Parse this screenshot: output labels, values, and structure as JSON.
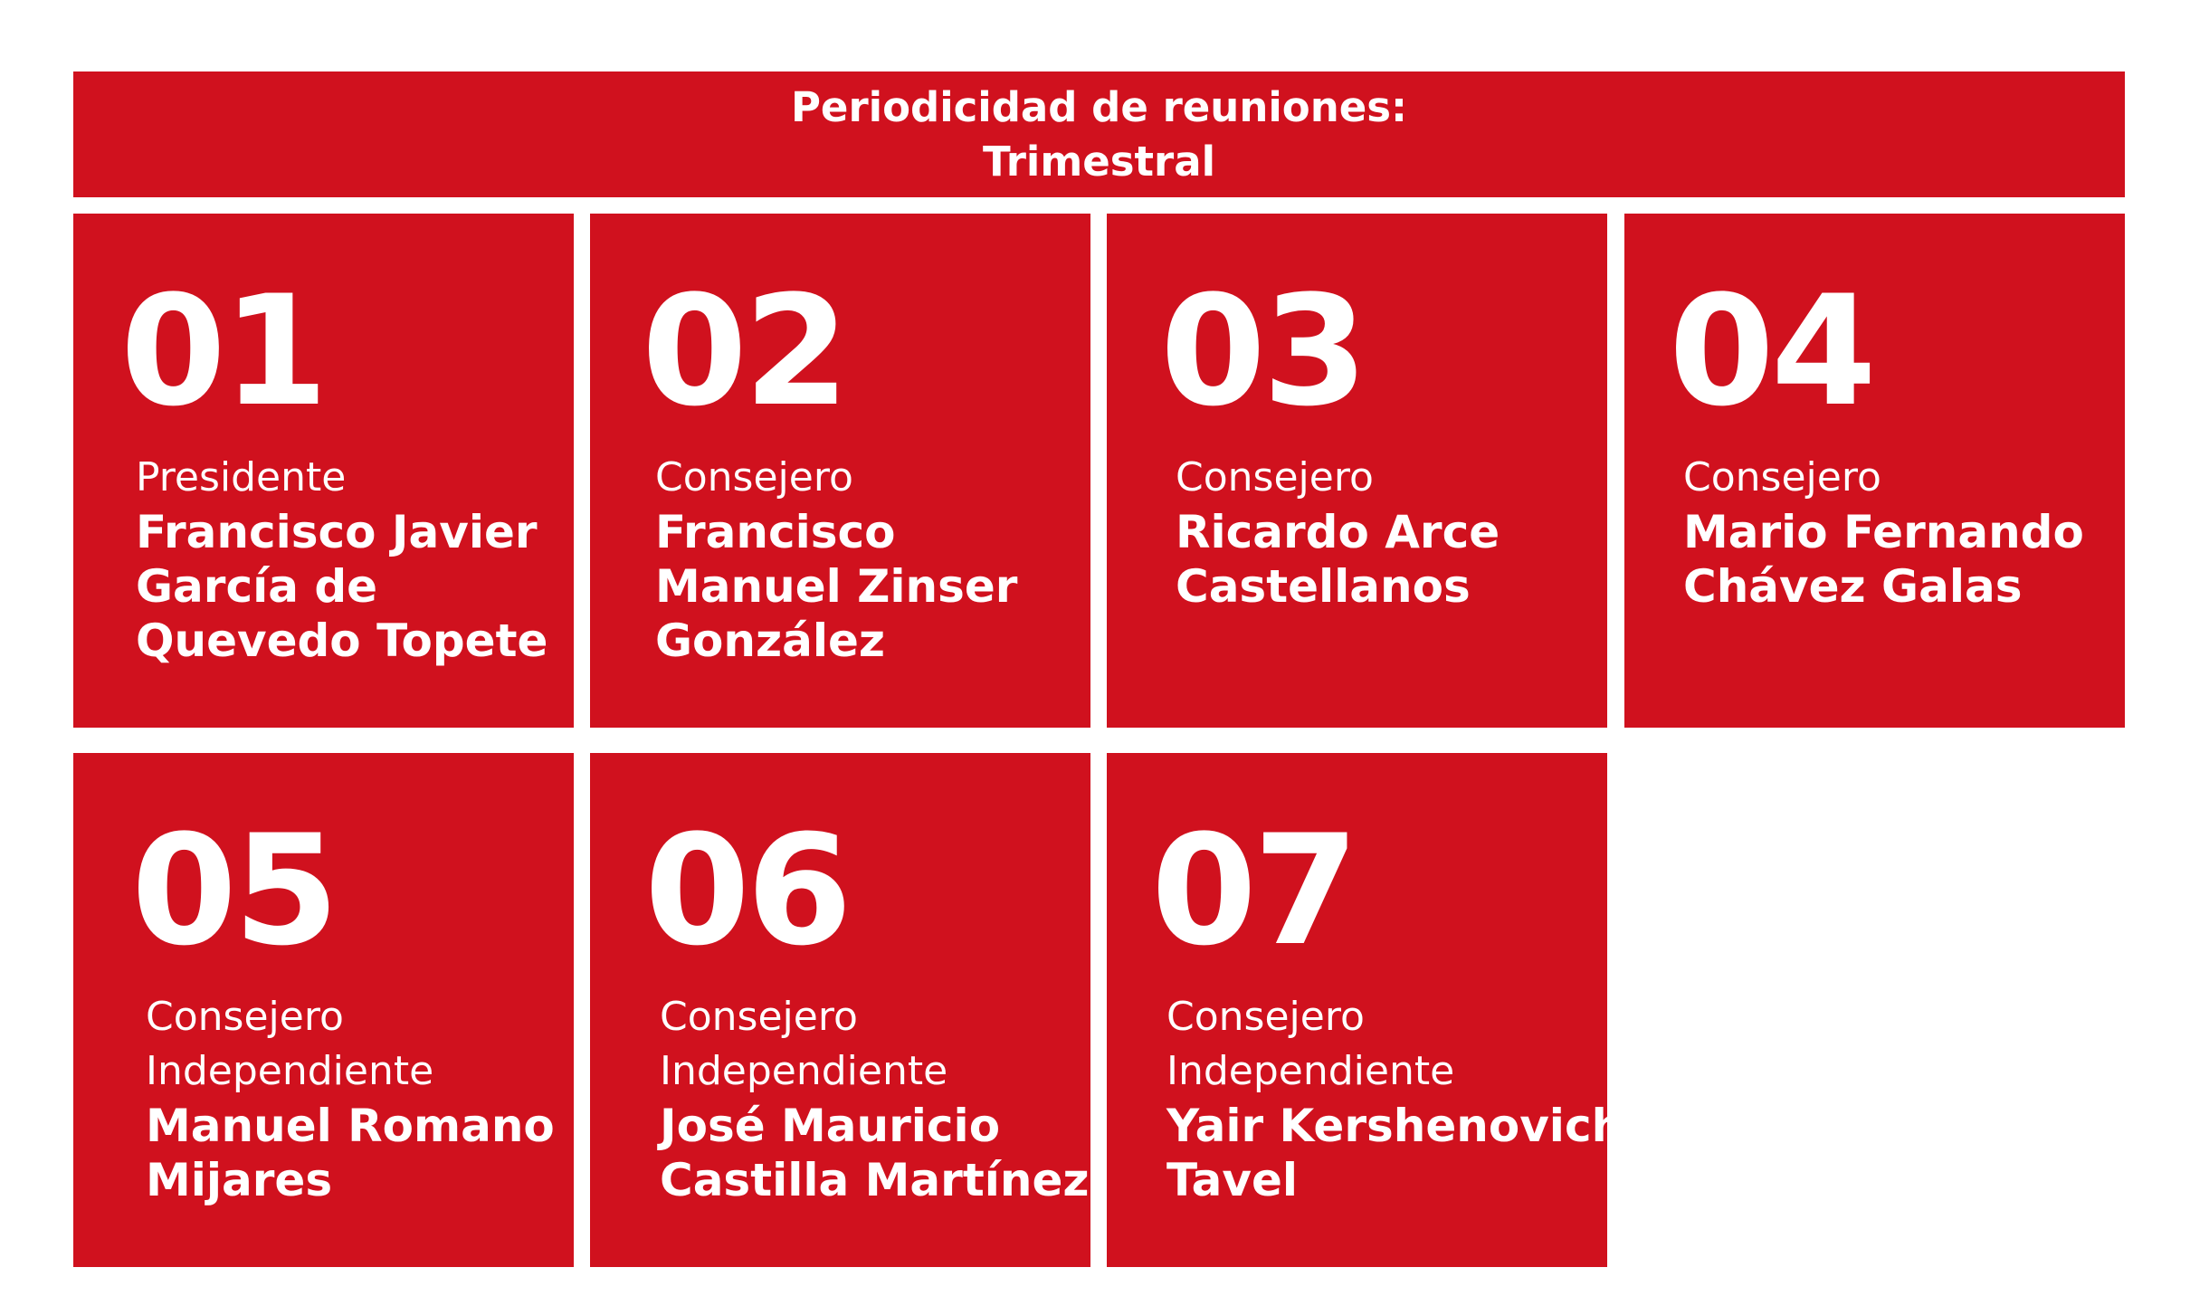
{
  "header": {
    "line1": "Periodicidad de reuniones:",
    "line2": "Trimestral"
  },
  "members": [
    {
      "number": "01",
      "role": [
        "Presidente"
      ],
      "name": [
        "Francisco Javier",
        "García de",
        "Quevedo Topete"
      ]
    },
    {
      "number": "02",
      "role": [
        "Consejero"
      ],
      "name": [
        "Francisco",
        "Manuel Zinser",
        "González"
      ]
    },
    {
      "number": "03",
      "role": [
        "Consejero"
      ],
      "name": [
        "Ricardo Arce",
        "Castellanos"
      ]
    },
    {
      "number": "04",
      "role": [
        "Consejero"
      ],
      "name": [
        "Mario Fernando",
        "Chávez Galas"
      ]
    },
    {
      "number": "05",
      "role": [
        "Consejero",
        "Independiente"
      ],
      "name": [
        "Manuel Romano",
        "Mijares"
      ]
    },
    {
      "number": "06",
      "role": [
        "Consejero",
        "Independiente"
      ],
      "name": [
        "José Mauricio",
        "Castilla Martínez"
      ]
    },
    {
      "number": "07",
      "role": [
        "Consejero",
        "Independiente"
      ],
      "name": [
        "Yair Kershenovich",
        "Tavel"
      ]
    }
  ],
  "colors": {
    "card_background": "#d0111e",
    "text": "#ffffff",
    "page_background": "#ffffff"
  }
}
